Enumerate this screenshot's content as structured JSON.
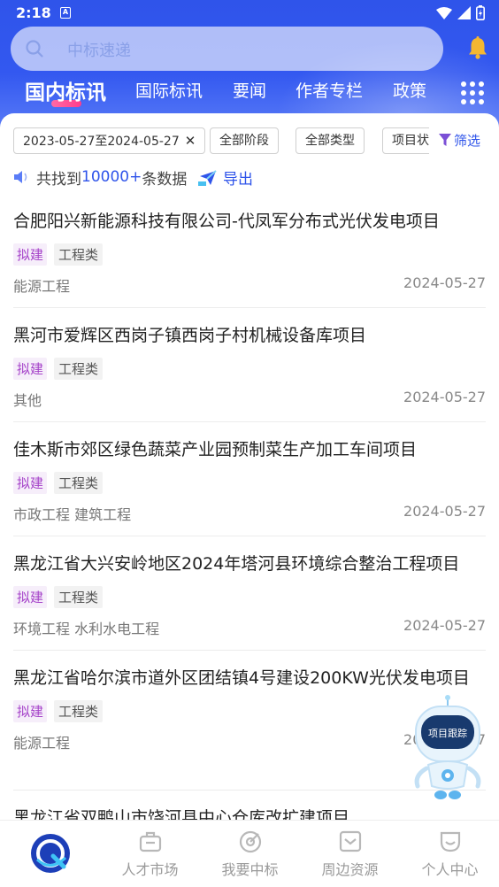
{
  "status_bar": {
    "time": "2:18",
    "indicator": "A"
  },
  "search": {
    "placeholder": "中标速递"
  },
  "tabs": [
    {
      "label": "国内标讯",
      "active": true
    },
    {
      "label": "国际标讯"
    },
    {
      "label": "要闻"
    },
    {
      "label": "作者专栏"
    },
    {
      "label": "政策"
    }
  ],
  "filters": {
    "date_range": "2023-05-27至2024-05-27",
    "stage": "全部阶段",
    "type": "全部类型",
    "project": "项目状",
    "filter_label": "筛选"
  },
  "results": {
    "prefix": "共找到",
    "count": "10000+",
    "suffix": "条数据",
    "export_label": "导出"
  },
  "items": [
    {
      "title": "合肥阳兴新能源科技有限公司-代凤军分布式光伏发电项目",
      "status": "拟建",
      "type": "工程类",
      "category": "能源工程",
      "date": "2024-05-27"
    },
    {
      "title": "黑河市爱辉区西岗子镇西岗子村机械设备库项目",
      "status": "拟建",
      "type": "工程类",
      "category": "其他",
      "date": "2024-05-27"
    },
    {
      "title": "佳木斯市郊区绿色蔬菜产业园预制菜生产加工车间项目",
      "status": "拟建",
      "type": "工程类",
      "category": "市政工程 建筑工程",
      "date": "2024-05-27"
    },
    {
      "title": "黑龙江省大兴安岭地区2024年塔河县环境综合整治工程项目",
      "status": "拟建",
      "type": "工程类",
      "category": "环境工程 水利水电工程",
      "date": "2024-05-27"
    },
    {
      "title": "黑龙江省哈尔滨市道外区团结镇4号建设200KW光伏发电项目",
      "status": "拟建",
      "type": "工程类",
      "category": "能源工程",
      "date": "2024-05-27"
    },
    {
      "title": "黑龙江省双鸭山市饶河县中心仓库改扩建项目"
    }
  ],
  "robot": {
    "label": "项目跟踪"
  },
  "bottom_nav": [
    {
      "label": ""
    },
    {
      "label": "人才市场"
    },
    {
      "label": "我要中标"
    },
    {
      "label": "周边资源"
    },
    {
      "label": "个人中心"
    }
  ],
  "colors": {
    "primary": "#2f54ea",
    "status_tag": "#a542c9",
    "bell": "#f5b731"
  }
}
